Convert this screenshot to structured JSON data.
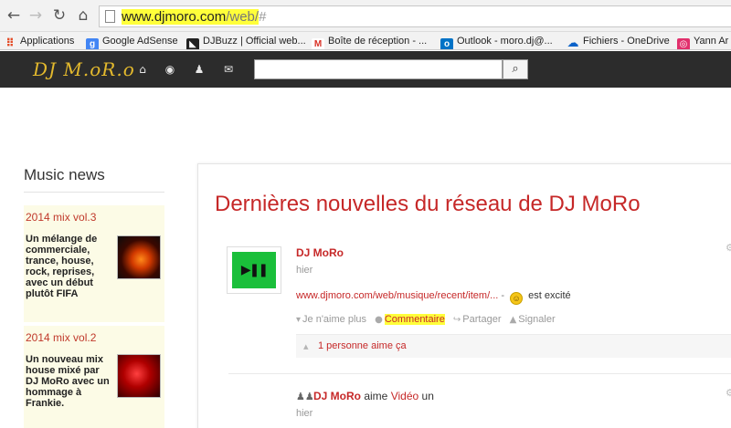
{
  "browser": {
    "url_host": "www.djmoro.com",
    "url_path": "/web/",
    "url_hash": "#"
  },
  "bookmarks": [
    {
      "label": "Applications",
      "icon": "apps-grid-icon",
      "color": "#e44b26"
    },
    {
      "label": "Google AdSense",
      "icon": "adsense-icon",
      "color": "#4285f4",
      "glyph": "g"
    },
    {
      "label": "DJBuzz | Official web...",
      "icon": "djbuzz-icon",
      "color": "#222222",
      "glyph": "◣"
    },
    {
      "label": "Boîte de réception - ...",
      "icon": "gmail-icon",
      "color": "#ffffff",
      "glyph": "M"
    },
    {
      "label": "Outlook - moro.dj@...",
      "icon": "outlook-icon",
      "color": "#0072c6",
      "glyph": "o"
    },
    {
      "label": "Fichiers - OneDrive",
      "icon": "onedrive-icon",
      "color": "#0a62c9",
      "glyph": "☁"
    },
    {
      "label": "Yann Ar",
      "icon": "instagram-icon",
      "color": "#e1306c",
      "glyph": "◎"
    }
  ],
  "site": {
    "logo": "DJ M.oR.o",
    "nav_icons": [
      "home-icon",
      "globe-icon",
      "users-icon",
      "envelope-icon"
    ],
    "search_placeholder": "",
    "search_icon": "search-icon"
  },
  "sidebar": {
    "title": "Music news",
    "items": [
      {
        "date": "2014 mix vol.3",
        "text": "Un mélange de commerciale, trance, house, rock, reprises, avec un début plutôt FIFA"
      },
      {
        "date": "2014 mix vol.2",
        "text": "Un nouveau mix house mixé par DJ MoRo avec un hommage à Frankie."
      }
    ]
  },
  "main": {
    "title": "Dernières nouvelles du réseau de DJ MoRo",
    "post1": {
      "author": "DJ MoRo",
      "time": "hier",
      "link": "www.djmoro.com/web/musique/recent/item/...",
      "separator": "-",
      "status": "est excité",
      "actions": {
        "unlike": "Je n'aime plus",
        "comment": "Commentaire",
        "share": "Partager",
        "report": "Signaler"
      },
      "likes": "1 personne aime ça"
    },
    "post2": {
      "author": "DJ MoRo",
      "verb": "aime",
      "object": "Vidéo",
      "suffix": "un",
      "time": "hier"
    }
  },
  "colors": {
    "accent_red": "#c62828",
    "header_dark": "#2c2c2c",
    "logo_gold": "#e3b92d",
    "highlight": "#ffff3a",
    "sidebar_card": "#fcfbe6"
  }
}
